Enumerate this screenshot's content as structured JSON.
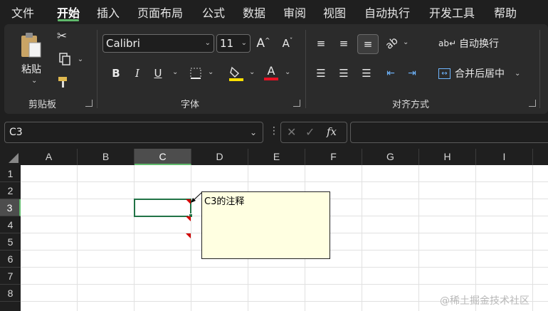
{
  "menu": {
    "tabs": [
      {
        "label": "文件"
      },
      {
        "label": "开始"
      },
      {
        "label": "插入"
      },
      {
        "label": "页面布局"
      },
      {
        "label": "公式"
      },
      {
        "label": "数据"
      },
      {
        "label": "审阅"
      },
      {
        "label": "视图"
      },
      {
        "label": "自动执行"
      },
      {
        "label": "开发工具"
      },
      {
        "label": "帮助"
      }
    ],
    "active_tab": "开始"
  },
  "ribbon": {
    "clipboard": {
      "paste_label": "粘贴",
      "group_label": "剪贴板"
    },
    "font": {
      "font_name": "Calibri",
      "font_size": "11",
      "bold": "B",
      "italic": "I",
      "underline": "U",
      "font_color_glyph": "A",
      "group_label": "字体",
      "highlight_color": "#ffe000",
      "font_color": "#e81123"
    },
    "alignment": {
      "wrap_text_label": "自动换行",
      "merge_center_label": "合并后居中",
      "group_label": "对齐方式"
    }
  },
  "formula_bar": {
    "name_box": "C3",
    "formula": "",
    "fx_label": "fx"
  },
  "sheet": {
    "columns": [
      "A",
      "B",
      "C",
      "D",
      "E",
      "F",
      "G",
      "H",
      "I"
    ],
    "rows": [
      "1",
      "2",
      "3",
      "4",
      "5",
      "6",
      "7",
      "8"
    ],
    "selected_cell": "C3",
    "comment_text": "C3的注释"
  },
  "watermark": "@稀土掘金技术社区",
  "colors": {
    "accent": "#5fb96b",
    "cell_border": "#217346",
    "comment_bg": "#ffffe1",
    "comment_indicator": "#d00000"
  }
}
